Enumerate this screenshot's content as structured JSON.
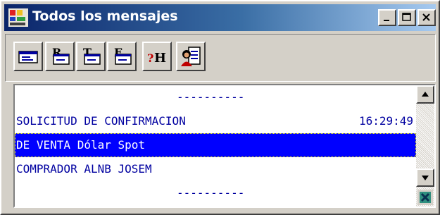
{
  "window": {
    "title": "Todos los mensajes",
    "title_colors": {
      "start": "#0a246a",
      "end": "#a6caf0"
    },
    "controls": [
      "minimize-icon",
      "maximize-icon",
      "close-icon"
    ]
  },
  "toolbar": {
    "buttons": [
      {
        "name": "message-button",
        "icon": "message-icon"
      },
      {
        "name": "r-message-button",
        "icon": "r-message-icon",
        "letter": "R"
      },
      {
        "name": "t-message-button",
        "icon": "t-message-icon",
        "letter": "T"
      },
      {
        "name": "e-message-button",
        "icon": "e-message-icon",
        "letter": "E"
      },
      {
        "name": "help-button",
        "icon": "help-icon",
        "letter": "?H"
      },
      {
        "name": "user-document-button",
        "icon": "user-document-icon"
      }
    ]
  },
  "messages": {
    "rows": [
      {
        "text": "----------",
        "time": ""
      },
      {
        "text": "SOLICITUD DE CONFIRMACION",
        "time": "16:29:49"
      },
      {
        "text": "DE VENTA Dólar Spot",
        "time": "",
        "selected": true
      },
      {
        "text": "COMPRADOR ALNB JOSEM",
        "time": ""
      },
      {
        "text": "----------",
        "time": ""
      }
    ],
    "text_color": "#0000a0",
    "selection_color": "#0000ff"
  },
  "scrollbar": {
    "up": "scroll-up-icon",
    "down": "scroll-down-icon",
    "corner": "close-x-icon"
  }
}
